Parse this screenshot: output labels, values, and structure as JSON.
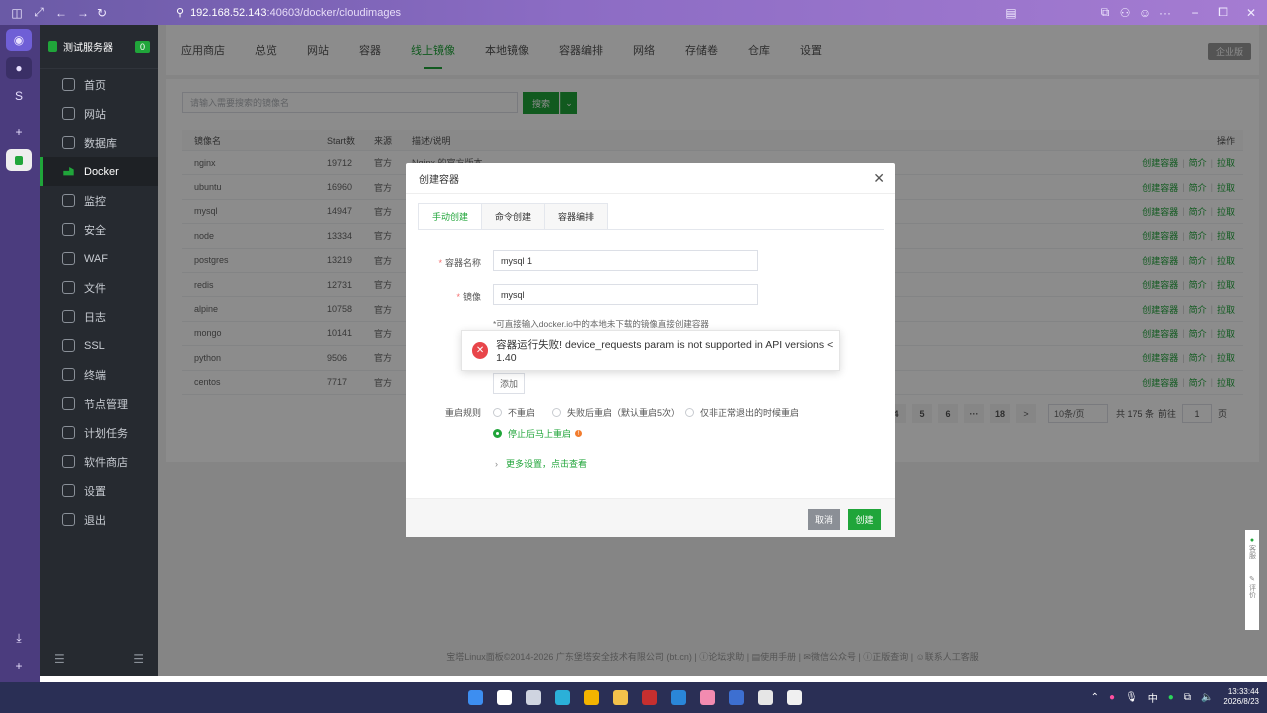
{
  "browser": {
    "url_host": "192.168.52.143",
    "url_path": ":40603/docker/cloudimages"
  },
  "sidebar": {
    "server_name": "测试服务器",
    "server_badge": "0",
    "items": [
      {
        "label": "首页",
        "icon": "home-icon"
      },
      {
        "label": "网站",
        "icon": "globe-icon"
      },
      {
        "label": "数据库",
        "icon": "database-icon"
      },
      {
        "label": "Docker",
        "icon": "docker-icon",
        "active": true
      },
      {
        "label": "监控",
        "icon": "monitor-icon"
      },
      {
        "label": "安全",
        "icon": "shield-icon"
      },
      {
        "label": "WAF",
        "icon": "waf-icon"
      },
      {
        "label": "文件",
        "icon": "folder-icon"
      },
      {
        "label": "日志",
        "icon": "log-icon"
      },
      {
        "label": "SSL",
        "icon": "ssl-icon"
      },
      {
        "label": "终端",
        "icon": "terminal-icon"
      },
      {
        "label": "节点管理",
        "icon": "node-icon"
      },
      {
        "label": "计划任务",
        "icon": "calendar-icon"
      },
      {
        "label": "软件商店",
        "icon": "store-icon"
      },
      {
        "label": "设置",
        "icon": "gear-icon"
      },
      {
        "label": "退出",
        "icon": "logout-icon"
      }
    ]
  },
  "top_tabs": [
    "应用商店",
    "总览",
    "网站",
    "容器",
    "线上镜像",
    "本地镜像",
    "容器编排",
    "网络",
    "存储卷",
    "仓库",
    "设置"
  ],
  "active_top_tab": "线上镜像",
  "enterprise_label": "企业版",
  "search": {
    "placeholder": "请输入需要搜索的镜像名",
    "button": "搜索"
  },
  "table": {
    "headers": {
      "name": "镜像名",
      "stars": "Start数",
      "source": "来源",
      "desc": "描述/说明",
      "ops": "操作"
    },
    "rows": [
      {
        "name": "nginx",
        "stars": "19712",
        "source": "官方",
        "desc": "Nginx 的官方版本"
      },
      {
        "name": "ubuntu",
        "stars": "16960",
        "source": "官方",
        "desc": ""
      },
      {
        "name": "mysql",
        "stars": "14947",
        "source": "官方",
        "desc": ""
      },
      {
        "name": "node",
        "stars": "13334",
        "source": "官方",
        "desc": ""
      },
      {
        "name": "postgres",
        "stars": "13219",
        "source": "官方",
        "desc": ""
      },
      {
        "name": "redis",
        "stars": "12731",
        "source": "官方",
        "desc": ""
      },
      {
        "name": "alpine",
        "stars": "10758",
        "source": "官方",
        "desc": ""
      },
      {
        "name": "mongo",
        "stars": "10141",
        "source": "官方",
        "desc": ""
      },
      {
        "name": "python",
        "stars": "9506",
        "source": "官方",
        "desc": ""
      },
      {
        "name": "centos",
        "stars": "7717",
        "source": "官方",
        "desc": ""
      }
    ],
    "op_create": "创建容器",
    "op_intro": "简介",
    "op_pull": "拉取"
  },
  "pager": {
    "pages": [
      "4",
      "5",
      "6",
      "···",
      "18"
    ],
    "next": ">",
    "page_size": "10条/页",
    "total": "共 175 条",
    "goto": "前往",
    "page_value": "1",
    "page_unit": "页"
  },
  "footer": "宝塔Linux面板©2014-2026 广东堡塔安全技术有限公司 (bt.cn)   |   ⓘ论坛求助   |   ▤使用手册   |   ✉微信公众号   |   ⓘ正版查询   |   ☺联系人工客服",
  "modal": {
    "title": "创建容器",
    "tabs": [
      "手动创建",
      "命令创建",
      "容器编排"
    ],
    "active_tab": "手动创建",
    "name_label": "容器名称",
    "name_value": "mysql 1",
    "image_label": "镜像",
    "image_value": "mysql",
    "hint": "*可直接输入docker.io中的本地未下载的镜像直接创建容器",
    "add_button": "添加",
    "restart_label": "重启规则",
    "restart_options": [
      "不重启",
      "失败后重启（默认重启5次）",
      "仅非正常退出的时候重启",
      "停止后马上重启"
    ],
    "restart_selected": "停止后马上重启",
    "more_settings": "更多设置，点击查看",
    "cancel": "取消",
    "create": "创建"
  },
  "toast": {
    "message": "容器运行失败! device_requests param is not supported in API versions < 1.40"
  },
  "float_buttons": [
    "客服",
    "评价"
  ],
  "taskbar": {
    "ime": "中",
    "time": "13:33:44",
    "date": "2026/8/23"
  },
  "colors": {
    "accent": "#20a53a",
    "error": "#e8454a",
    "sidebar_bg": "#262a30"
  }
}
